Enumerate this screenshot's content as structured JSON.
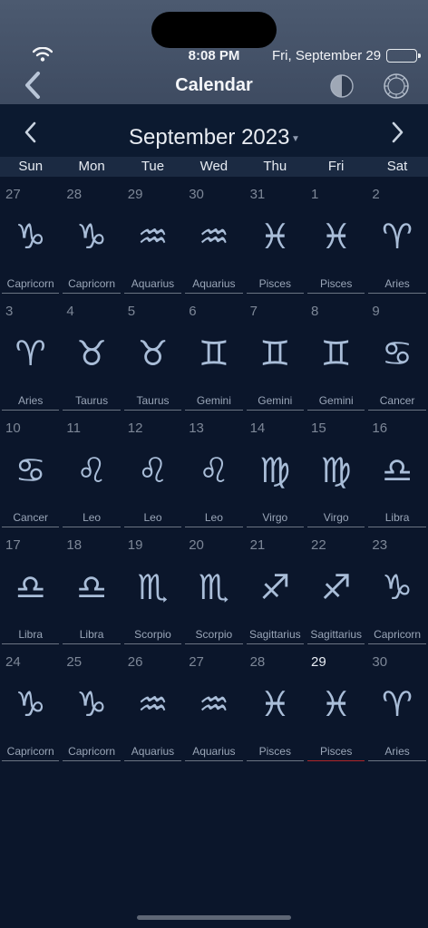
{
  "status": {
    "time": "8:08 PM",
    "date": "Fri, September 29"
  },
  "nav": {
    "title": "Calendar"
  },
  "calendar": {
    "month_label": "September 2023",
    "weekdays": [
      "Sun",
      "Mon",
      "Tue",
      "Wed",
      "Thu",
      "Fri",
      "Sat"
    ],
    "today": "29",
    "days": [
      {
        "day": "27",
        "sign": "Capricorn",
        "glyph": "♑"
      },
      {
        "day": "28",
        "sign": "Capricorn",
        "glyph": "♑"
      },
      {
        "day": "29",
        "sign": "Aquarius",
        "glyph": "♒"
      },
      {
        "day": "30",
        "sign": "Aquarius",
        "glyph": "♒"
      },
      {
        "day": "31",
        "sign": "Pisces",
        "glyph": "♓"
      },
      {
        "day": "1",
        "sign": "Pisces",
        "glyph": "♓"
      },
      {
        "day": "2",
        "sign": "Aries",
        "glyph": "♈"
      },
      {
        "day": "3",
        "sign": "Aries",
        "glyph": "♈"
      },
      {
        "day": "4",
        "sign": "Taurus",
        "glyph": "♉"
      },
      {
        "day": "5",
        "sign": "Taurus",
        "glyph": "♉"
      },
      {
        "day": "6",
        "sign": "Gemini",
        "glyph": "♊"
      },
      {
        "day": "7",
        "sign": "Gemini",
        "glyph": "♊"
      },
      {
        "day": "8",
        "sign": "Gemini",
        "glyph": "♊"
      },
      {
        "day": "9",
        "sign": "Cancer",
        "glyph": "♋"
      },
      {
        "day": "10",
        "sign": "Cancer",
        "glyph": "♋"
      },
      {
        "day": "11",
        "sign": "Leo",
        "glyph": "♌"
      },
      {
        "day": "12",
        "sign": "Leo",
        "glyph": "♌"
      },
      {
        "day": "13",
        "sign": "Leo",
        "glyph": "♌"
      },
      {
        "day": "14",
        "sign": "Virgo",
        "glyph": "♍"
      },
      {
        "day": "15",
        "sign": "Virgo",
        "glyph": "♍"
      },
      {
        "day": "16",
        "sign": "Libra",
        "glyph": "♎"
      },
      {
        "day": "17",
        "sign": "Libra",
        "glyph": "♎"
      },
      {
        "day": "18",
        "sign": "Libra",
        "glyph": "♎"
      },
      {
        "day": "19",
        "sign": "Scorpio",
        "glyph": "♏"
      },
      {
        "day": "20",
        "sign": "Scorpio",
        "glyph": "♏"
      },
      {
        "day": "21",
        "sign": "Sagittarius",
        "glyph": "♐"
      },
      {
        "day": "22",
        "sign": "Sagittarius",
        "glyph": "♐"
      },
      {
        "day": "23",
        "sign": "Capricorn",
        "glyph": "♑"
      },
      {
        "day": "24",
        "sign": "Capricorn",
        "glyph": "♑"
      },
      {
        "day": "25",
        "sign": "Capricorn",
        "glyph": "♑"
      },
      {
        "day": "26",
        "sign": "Aquarius",
        "glyph": "♒"
      },
      {
        "day": "27",
        "sign": "Aquarius",
        "glyph": "♒"
      },
      {
        "day": "28",
        "sign": "Pisces",
        "glyph": "♓"
      },
      {
        "day": "29",
        "sign": "Pisces",
        "glyph": "♓",
        "today": true
      },
      {
        "day": "30",
        "sign": "Aries",
        "glyph": "♈"
      }
    ]
  },
  "icons": {
    "back": "chevron-left-icon",
    "moon": "moon-phase-icon",
    "sun": "sun-icon",
    "prev": "chevron-left-icon",
    "next": "chevron-right-icon"
  },
  "colors": {
    "background": "#0b162b",
    "header": "#44526a",
    "today_underline": "#b0262a",
    "glyph": "#a9bdd8"
  }
}
